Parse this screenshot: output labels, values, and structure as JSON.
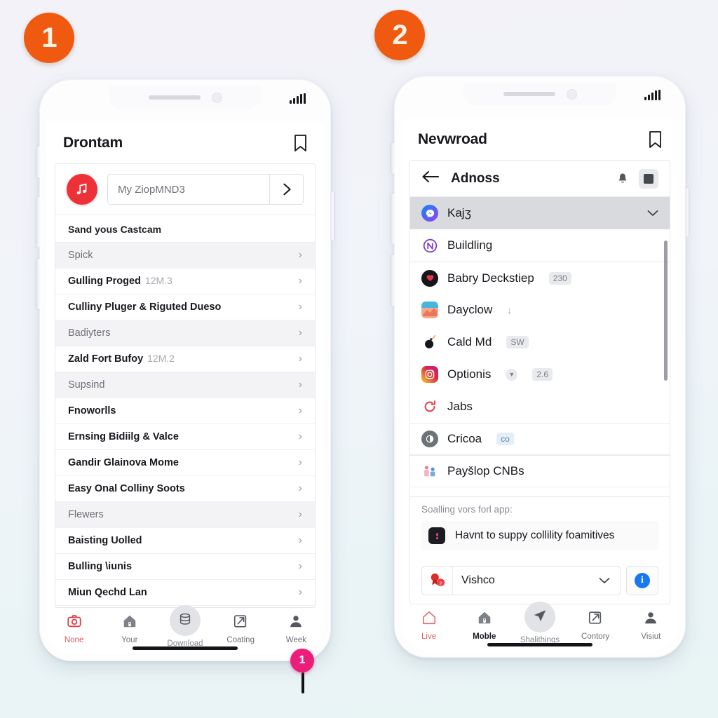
{
  "steps": [
    {
      "number": "1"
    },
    {
      "number": "2"
    }
  ],
  "phone1": {
    "status": {
      "signal_icon": "signal-bars-icon"
    },
    "header": {
      "title": "Drontam",
      "action_icon": "tag-icon"
    },
    "search": {
      "leading_icon": "music-note-icon",
      "value": "My ZiopMND3",
      "go_icon": "chevron-right-icon"
    },
    "section_label": "Sand yous Castcam",
    "list": [
      {
        "label": "Spick",
        "sub": "",
        "muted": true
      },
      {
        "label": "Gulling Proged",
        "sub": "12M.3",
        "muted": false
      },
      {
        "label": "Culliny Pluger & Riguted Dueso",
        "sub": "",
        "muted": false
      },
      {
        "label": "Badiyters",
        "sub": "",
        "muted": true
      },
      {
        "label": "Zald Fort Bufoy",
        "sub": "12M.2",
        "muted": false
      },
      {
        "label": "Supsind",
        "sub": "",
        "muted": true
      },
      {
        "label": "Fnoworlls",
        "sub": "",
        "muted": false
      },
      {
        "label": "Ernsing Bidiilg & Valce",
        "sub": "",
        "muted": false
      },
      {
        "label": "Gandir Glainova Mome",
        "sub": "",
        "muted": false
      },
      {
        "label": "Easy Onal Colliny Soots",
        "sub": "",
        "muted": false
      },
      {
        "label": "Flewers",
        "sub": "",
        "muted": true
      },
      {
        "label": "Baisting Uolled",
        "sub": "",
        "muted": false
      },
      {
        "label": "Bulling \\iunis",
        "sub": "",
        "muted": false
      },
      {
        "label": "Miun Qechd Lan",
        "sub": "",
        "muted": false
      }
    ],
    "chevron": "›",
    "pin": {
      "label": "1",
      "color": "#ec1e79"
    },
    "tabs": [
      {
        "label": "None",
        "icon": "camera-icon",
        "state": "active-red"
      },
      {
        "label": "Your",
        "icon": "home-icon",
        "state": "normal"
      },
      {
        "label": "Download",
        "icon": "database-icon",
        "state": "center"
      },
      {
        "label": "Coating",
        "icon": "share-icon",
        "state": "normal"
      },
      {
        "label": "Week",
        "icon": "person-icon",
        "state": "normal"
      }
    ]
  },
  "phone2": {
    "status": {
      "signal_icon": "signal-bars-icon"
    },
    "header": {
      "title": "Nevwroad",
      "action_icon": "tag-icon"
    },
    "sub_header": {
      "back_icon": "arrow-left-icon",
      "title": "Adnoss",
      "bell_icon": "bell-icon",
      "square_icon": "square-button-icon"
    },
    "groups": [
      {
        "rows": [
          {
            "label": "Kajʒ",
            "icon": "messenger-icon",
            "color": "#1b74e4",
            "badge": "",
            "badge_style": "",
            "trailing": "chevron-down",
            "selected": true
          },
          {
            "label": "Buildling",
            "icon": "nordvpn-icon",
            "color": "#ffffff",
            "badge": "",
            "badge_style": "",
            "trailing": "",
            "selected": false
          }
        ]
      },
      {
        "rows": [
          {
            "label": "Babry Deckstiep",
            "icon": "heart-dark-icon",
            "color": "#17181c",
            "badge": "230",
            "badge_style": "gray",
            "trailing": "",
            "selected": false
          },
          {
            "label": "Dayclow",
            "icon": "wallet-icon",
            "color": "#f08a6e",
            "badge": "",
            "badge_style": "download",
            "trailing": "",
            "selected": false
          },
          {
            "label": "Cald Md",
            "icon": "bomb-icon",
            "color": "#17181c",
            "badge": "SW",
            "badge_style": "gray",
            "trailing": "",
            "selected": false
          },
          {
            "label": "Optionis",
            "icon": "instagram-icon",
            "color": "#d62976",
            "badge": "2.6",
            "badge_style": "gray",
            "trailing": "mini-chevron",
            "selected": false
          },
          {
            "label": "Jabs",
            "icon": "refresh-red-icon",
            "color": "#e8404a",
            "badge": "",
            "badge_style": "",
            "trailing": "",
            "selected": false
          }
        ]
      },
      {
        "rows": [
          {
            "label": "Cricoa",
            "icon": "gray-disc-icon",
            "color": "#6f7278",
            "badge": "co",
            "badge_style": "blue",
            "trailing": "",
            "selected": false
          }
        ]
      },
      {
        "rows": [
          {
            "label": "Payšlop CNBs",
            "icon": "people-icon",
            "color": "#7a9ed6",
            "badge": "",
            "badge_style": "",
            "trailing": "",
            "selected": false
          }
        ]
      }
    ],
    "hint": {
      "text": "Soalling vors forl app:",
      "row_label": "Havnt to suppy collility foamitives",
      "row_icon": "dark-app-icon"
    },
    "select": {
      "leading_icon": "badges-icon",
      "value": "Vishco",
      "caret": "⌄",
      "info_icon": "info-icon",
      "info_label": "i"
    },
    "tabs": [
      {
        "label": "Live",
        "icon": "home-outline-icon",
        "state": "active-red"
      },
      {
        "label": "Moble",
        "icon": "home-icon",
        "state": "active-dark"
      },
      {
        "label": "Shalithings",
        "icon": "send-icon",
        "state": "center"
      },
      {
        "label": "Contory",
        "icon": "share-icon",
        "state": "normal"
      },
      {
        "label": "Visiut",
        "icon": "person-icon",
        "state": "normal"
      }
    ]
  }
}
